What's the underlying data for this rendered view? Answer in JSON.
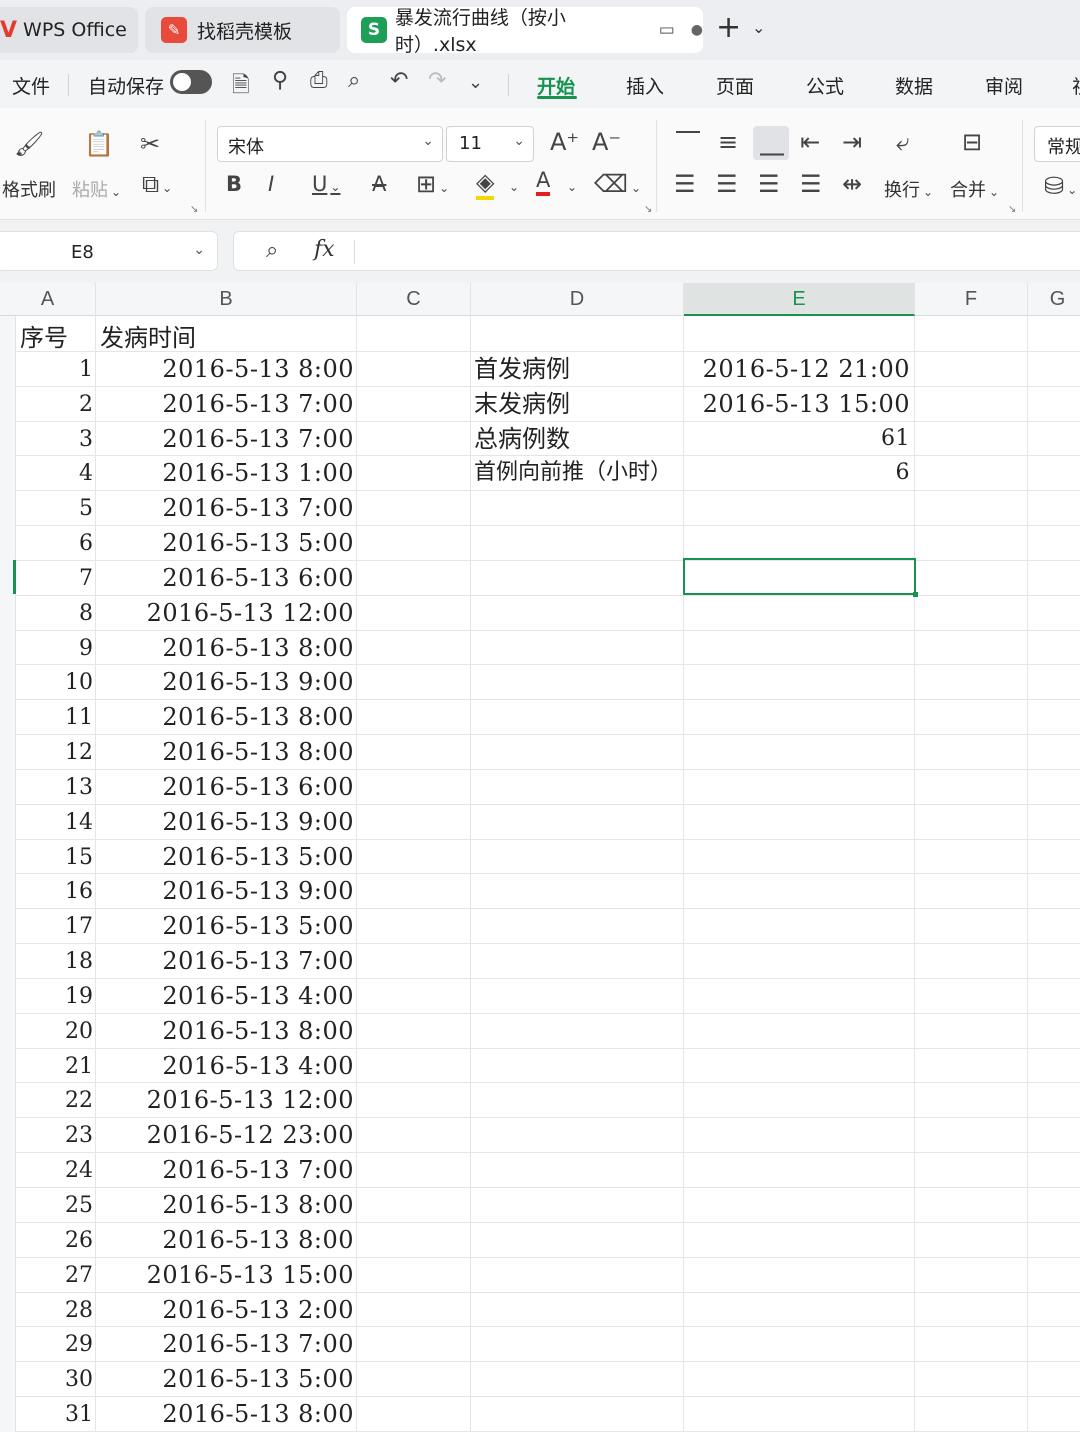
{
  "tabs": [
    {
      "label": "WPS Office"
    },
    {
      "label": "找稻壳模板"
    },
    {
      "label": "暴发流行曲线（按小时）.xlsx"
    }
  ],
  "menu": {
    "file": "文件",
    "autosave": "自动保存",
    "items": [
      "开始",
      "插入",
      "页面",
      "公式",
      "数据",
      "审阅"
    ],
    "active": "开始"
  },
  "ribbon": {
    "format_painter": "格式刷",
    "paste": "粘贴",
    "font_name": "宋体",
    "font_size": "11",
    "wrap": "换行",
    "merge": "合并",
    "number_format": "常规",
    "font_color": "#e02020",
    "fill_color": "#f5d800"
  },
  "formula_bar": {
    "name_box": "E8",
    "fx": "fx",
    "formula": ""
  },
  "columns": [
    "A",
    "B",
    "C",
    "D",
    "E",
    "F"
  ],
  "active_column": "E",
  "selected_cell": "E8",
  "sheet": {
    "header": {
      "A": "序号",
      "B": "发病时间"
    },
    "rows": [
      {
        "seq": "1",
        "time": "2016-5-13  8:00"
      },
      {
        "seq": "2",
        "time": "2016-5-13  7:00"
      },
      {
        "seq": "3",
        "time": "2016-5-13  7:00"
      },
      {
        "seq": "4",
        "time": "2016-5-13  1:00"
      },
      {
        "seq": "5",
        "time": "2016-5-13  7:00"
      },
      {
        "seq": "6",
        "time": "2016-5-13  5:00"
      },
      {
        "seq": "7",
        "time": "2016-5-13  6:00"
      },
      {
        "seq": "8",
        "time": "2016-5-13  12:00"
      },
      {
        "seq": "9",
        "time": "2016-5-13  8:00"
      },
      {
        "seq": "10",
        "time": "2016-5-13  9:00"
      },
      {
        "seq": "11",
        "time": "2016-5-13  8:00"
      },
      {
        "seq": "12",
        "time": "2016-5-13  8:00"
      },
      {
        "seq": "13",
        "time": "2016-5-13  6:00"
      },
      {
        "seq": "14",
        "time": "2016-5-13  9:00"
      },
      {
        "seq": "15",
        "time": "2016-5-13  5:00"
      },
      {
        "seq": "16",
        "time": "2016-5-13  9:00"
      },
      {
        "seq": "17",
        "time": "2016-5-13  5:00"
      },
      {
        "seq": "18",
        "time": "2016-5-13  7:00"
      },
      {
        "seq": "19",
        "time": "2016-5-13  4:00"
      },
      {
        "seq": "20",
        "time": "2016-5-13  8:00"
      },
      {
        "seq": "21",
        "time": "2016-5-13  4:00"
      },
      {
        "seq": "22",
        "time": "2016-5-13  12:00"
      },
      {
        "seq": "23",
        "time": "2016-5-12  23:00"
      },
      {
        "seq": "24",
        "time": "2016-5-13  7:00"
      },
      {
        "seq": "25",
        "time": "2016-5-13  8:00"
      },
      {
        "seq": "26",
        "time": "2016-5-13  8:00"
      },
      {
        "seq": "27",
        "time": "2016-5-13  15:00"
      },
      {
        "seq": "28",
        "time": "2016-5-13  2:00"
      },
      {
        "seq": "29",
        "time": "2016-5-13  7:00"
      },
      {
        "seq": "30",
        "time": "2016-5-13  5:00"
      },
      {
        "seq": "31",
        "time": "2016-5-13  8:00"
      }
    ],
    "summary": [
      {
        "label": "首发病例",
        "value": "2016-5-12  21:00"
      },
      {
        "label": "末发病例",
        "value": "2016-5-13  15:00"
      },
      {
        "label": "总病例数",
        "value": "61"
      },
      {
        "label": "首例向前推（小时）",
        "value": "6"
      }
    ]
  }
}
